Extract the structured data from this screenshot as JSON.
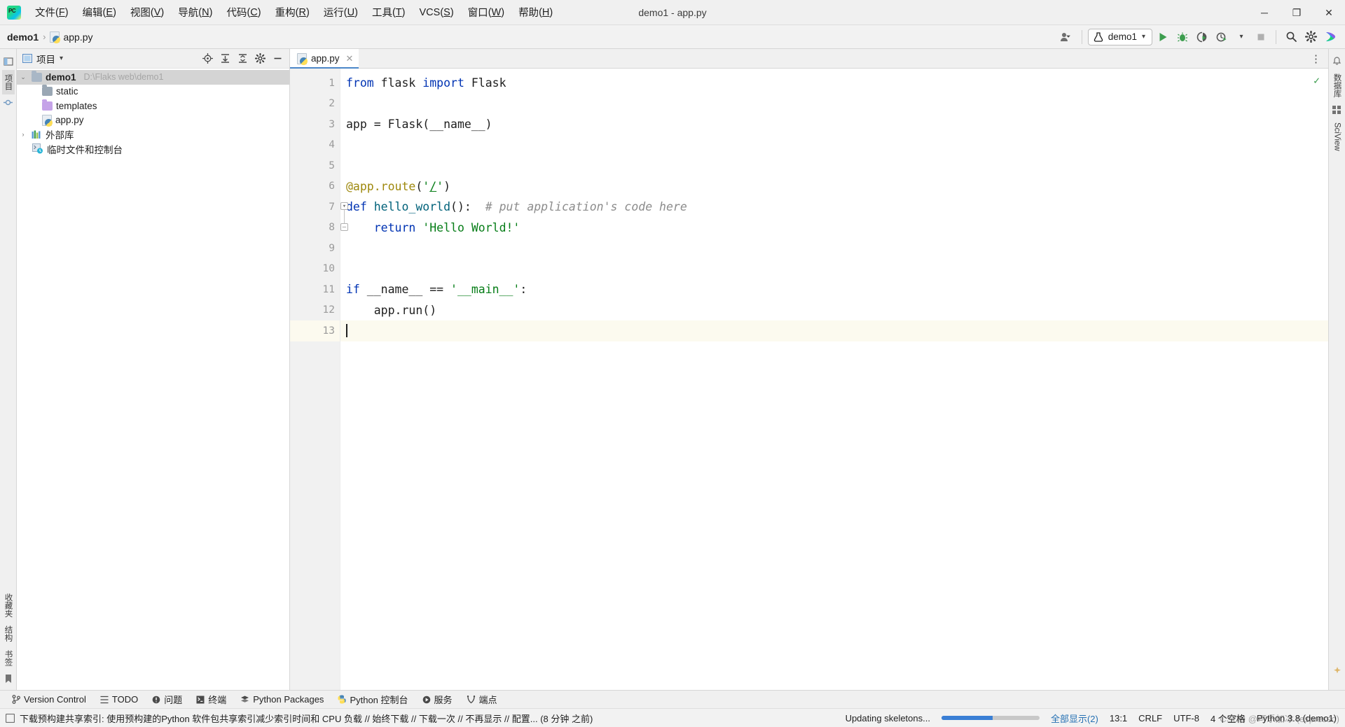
{
  "window": {
    "title": "demo1 - app.py",
    "minimize": "─",
    "maximize": "❐",
    "close": "✕"
  },
  "menu": {
    "items": [
      {
        "label": "文件",
        "mnemonic": "F"
      },
      {
        "label": "编辑",
        "mnemonic": "E"
      },
      {
        "label": "视图",
        "mnemonic": "V"
      },
      {
        "label": "导航",
        "mnemonic": "N"
      },
      {
        "label": "代码",
        "mnemonic": "C"
      },
      {
        "label": "重构",
        "mnemonic": "R"
      },
      {
        "label": "运行",
        "mnemonic": "U"
      },
      {
        "label": "工具",
        "mnemonic": "T"
      },
      {
        "label": "VCS",
        "mnemonic": "S"
      },
      {
        "label": "窗口",
        "mnemonic": "W"
      },
      {
        "label": "帮助",
        "mnemonic": "H"
      }
    ]
  },
  "navbar": {
    "breadcrumb": {
      "project": "demo1",
      "separator": "›",
      "file": "app.py"
    },
    "run_config": {
      "name": "demo1",
      "dropdown_caret": "▾"
    },
    "buttons": {
      "user": "user-icon",
      "run": "run-icon",
      "debug": "debug-icon",
      "run_coverage": "run-coverage-icon",
      "profile": "profile-icon",
      "stop": "stop-icon",
      "search": "search-icon",
      "settings": "settings-icon",
      "assistant": "ai-assistant-icon"
    }
  },
  "left_strip": {
    "tabs": [
      "项目",
      "收藏夹",
      "结构",
      "书签"
    ]
  },
  "right_strip": {
    "tabs": [
      "数据库",
      "SciView"
    ]
  },
  "project_panel": {
    "title": "项目",
    "dropdown_caret": "▾",
    "actions": [
      "locate-icon",
      "expand-all-icon",
      "collapse-all-icon",
      "settings-icon",
      "hide-icon"
    ],
    "tree": [
      {
        "label": "demo1",
        "path": "D:\\Flaks web\\demo1",
        "icon": "folder-gray",
        "arrow": "⌄",
        "indent": 0,
        "selected": true,
        "bold": true
      },
      {
        "label": "static",
        "path": "",
        "icon": "folder-gray",
        "arrow": "",
        "indent": 1,
        "selected": false,
        "bold": false
      },
      {
        "label": "templates",
        "path": "",
        "icon": "folder-purple",
        "arrow": "",
        "indent": 1,
        "selected": false,
        "bold": false
      },
      {
        "label": "app.py",
        "path": "",
        "icon": "python-file",
        "arrow": "",
        "indent": 1,
        "selected": false,
        "bold": false
      },
      {
        "label": "外部库",
        "path": "",
        "icon": "library",
        "arrow": "›",
        "indent": 0,
        "selected": false,
        "bold": false
      },
      {
        "label": "临时文件和控制台",
        "path": "",
        "icon": "scratches",
        "arrow": "",
        "indent": 0,
        "selected": false,
        "bold": false
      }
    ]
  },
  "editor": {
    "tabs": [
      {
        "label": "app.py",
        "icon": "python-file",
        "active": true,
        "close": "✕"
      }
    ],
    "more_button": "⋮",
    "inspection_status": "✓",
    "caret_line": 13,
    "lines": [
      {
        "n": 1,
        "tokens": [
          {
            "t": "from",
            "c": "k"
          },
          {
            "t": " flask ",
            "c": "pl"
          },
          {
            "t": "import",
            "c": "k"
          },
          {
            "t": " Flask",
            "c": "pl"
          }
        ]
      },
      {
        "n": 2,
        "tokens": []
      },
      {
        "n": 3,
        "tokens": [
          {
            "t": "app = Flask(__name__)",
            "c": "pl"
          }
        ]
      },
      {
        "n": 4,
        "tokens": []
      },
      {
        "n": 5,
        "tokens": []
      },
      {
        "n": 6,
        "tokens": [
          {
            "t": "@app.route",
            "c": "dec"
          },
          {
            "t": "(",
            "c": "pl"
          },
          {
            "t": "'",
            "c": "str"
          },
          {
            "t": "/",
            "c": "lnk"
          },
          {
            "t": "'",
            "c": "str"
          },
          {
            "t": ")",
            "c": "pl"
          }
        ]
      },
      {
        "n": 7,
        "tokens": [
          {
            "t": "def ",
            "c": "k"
          },
          {
            "t": "hello_world",
            "c": "fn"
          },
          {
            "t": "():",
            "c": "pl"
          },
          {
            "t": "  # put application's code here",
            "c": "cmt"
          }
        ]
      },
      {
        "n": 8,
        "tokens": [
          {
            "t": "    ",
            "c": "pl"
          },
          {
            "t": "return",
            "c": "k"
          },
          {
            "t": " ",
            "c": "pl"
          },
          {
            "t": "'Hello World!'",
            "c": "str"
          }
        ]
      },
      {
        "n": 9,
        "tokens": []
      },
      {
        "n": 10,
        "tokens": []
      },
      {
        "n": 11,
        "tokens": [
          {
            "t": "if",
            "c": "k"
          },
          {
            "t": " __name__ == ",
            "c": "pl"
          },
          {
            "t": "'__main__'",
            "c": "str"
          },
          {
            "t": ":",
            "c": "pl"
          }
        ]
      },
      {
        "n": 12,
        "tokens": [
          {
            "t": "    app.run()",
            "c": "pl"
          }
        ]
      },
      {
        "n": 13,
        "tokens": []
      }
    ],
    "gutter_run_line": 11,
    "fold_lines": [
      7,
      8
    ]
  },
  "tool_windows": {
    "items": [
      {
        "label": "Version Control",
        "icon": "branch-icon"
      },
      {
        "label": "TODO",
        "icon": "list-icon"
      },
      {
        "label": "问题",
        "icon": "problems-icon"
      },
      {
        "label": "终端",
        "icon": "terminal-icon"
      },
      {
        "label": "Python Packages",
        "icon": "packages-icon"
      },
      {
        "label": "Python 控制台",
        "icon": "python-console-icon"
      },
      {
        "label": "服务",
        "icon": "services-icon"
      },
      {
        "label": "端点",
        "icon": "endpoints-icon"
      }
    ]
  },
  "status_bar": {
    "message": "下载预构建共享索引: 使用预构建的Python 软件包共享索引减少索引时间和 CPU 负载 // 始终下载 // 下载一次 // 不再显示 // 配置... (8 分钟 之前)",
    "message_icon": "notification-icon",
    "progress_label": "Updating skeletons...",
    "progress_percent": 52,
    "progress_color": "#3a7fd5",
    "show_all": "全部显示(2)",
    "caret_position": "13:1",
    "line_separator": "CRLF",
    "encoding": "UTF-8",
    "indent": "4 个空格",
    "interpreter": "Python 3.8 (demo1)",
    "watermark": "CSDN @可乐加冰 (espresso)"
  }
}
